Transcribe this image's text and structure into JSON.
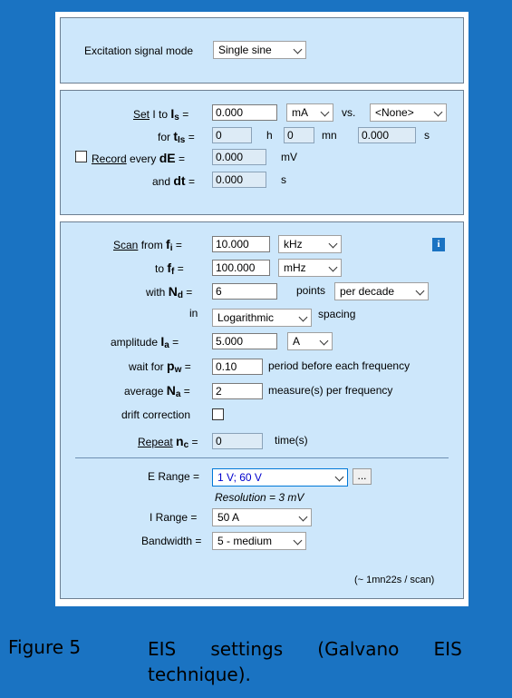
{
  "excitation": {
    "label": "Excitation signal mode",
    "value": "Single sine"
  },
  "set_group": {
    "set_word": "Set",
    "set_rest": "I to",
    "is_symbol": "I",
    "is_sub": "s",
    "eq": "=",
    "is_value": "0.000",
    "is_unit": "mA",
    "vs_label": "vs.",
    "vs_value": "<None>",
    "for_label": "for",
    "tis_symbol": "t",
    "tis_sub": "Is",
    "h_value": "0",
    "h_unit": "h",
    "mn_value": "0",
    "mn_unit": "mn",
    "s_value": "0.000",
    "s_unit": "s",
    "record_word": "Record",
    "record_rest": "every",
    "de_symbol": "dE",
    "de_value": "0.000",
    "de_unit": "mV",
    "and_label": "and",
    "dt_symbol": "dt",
    "dt_value": "0.000",
    "dt_unit": "s"
  },
  "scan_group": {
    "scan_word": "Scan",
    "scan_rest": "from",
    "fi_symbol": "f",
    "fi_sub": "i",
    "fi_value": "10.000",
    "fi_unit": "kHz",
    "info_glyph": "i",
    "to_label": "to",
    "ff_symbol": "f",
    "ff_sub": "f",
    "ff_value": "100.000",
    "ff_unit": "mHz",
    "with_label": "with",
    "nd_symbol": "N",
    "nd_sub": "d",
    "nd_value": "6",
    "points_label": "points",
    "nd_mode": "per decade",
    "in_label": "in",
    "spacing_value": "Logarithmic",
    "spacing_label": "spacing",
    "amp_label": "amplitude",
    "ia_symbol": "I",
    "ia_sub": "a",
    "ia_value": "5.000",
    "ia_unit": "A",
    "wait_label": "wait for",
    "pw_symbol": "p",
    "pw_sub": "w",
    "pw_value": "0.10",
    "pw_text": "period before each frequency",
    "avg_label": "average",
    "na_symbol": "N",
    "na_sub": "a",
    "na_value": "2",
    "na_text": "measure(s) per frequency",
    "drift_label": "drift correction",
    "repeat_word": "Repeat",
    "nc_symbol": "n",
    "nc_sub": "c",
    "nc_value": "0",
    "nc_text": "time(s)",
    "erange_label": "E Range =",
    "erange_value": "1 V; 60 V",
    "erange_more": "...",
    "resolution": "Resolution = 3 mV",
    "irange_label": "I Range =",
    "irange_value": "50 A",
    "bw_label": "Bandwidth =",
    "bw_value": "5 - medium",
    "duration": "(~ 1mn22s / scan)"
  },
  "caption": {
    "number": "Figure 5",
    "text_line1": "EIS      settings      (Galvano      EIS",
    "text_line2": "technique)."
  },
  "colors": {
    "page_bg": "#1a73c2",
    "group_bg": "#cde7fb",
    "erange_text": "#0000cc"
  }
}
